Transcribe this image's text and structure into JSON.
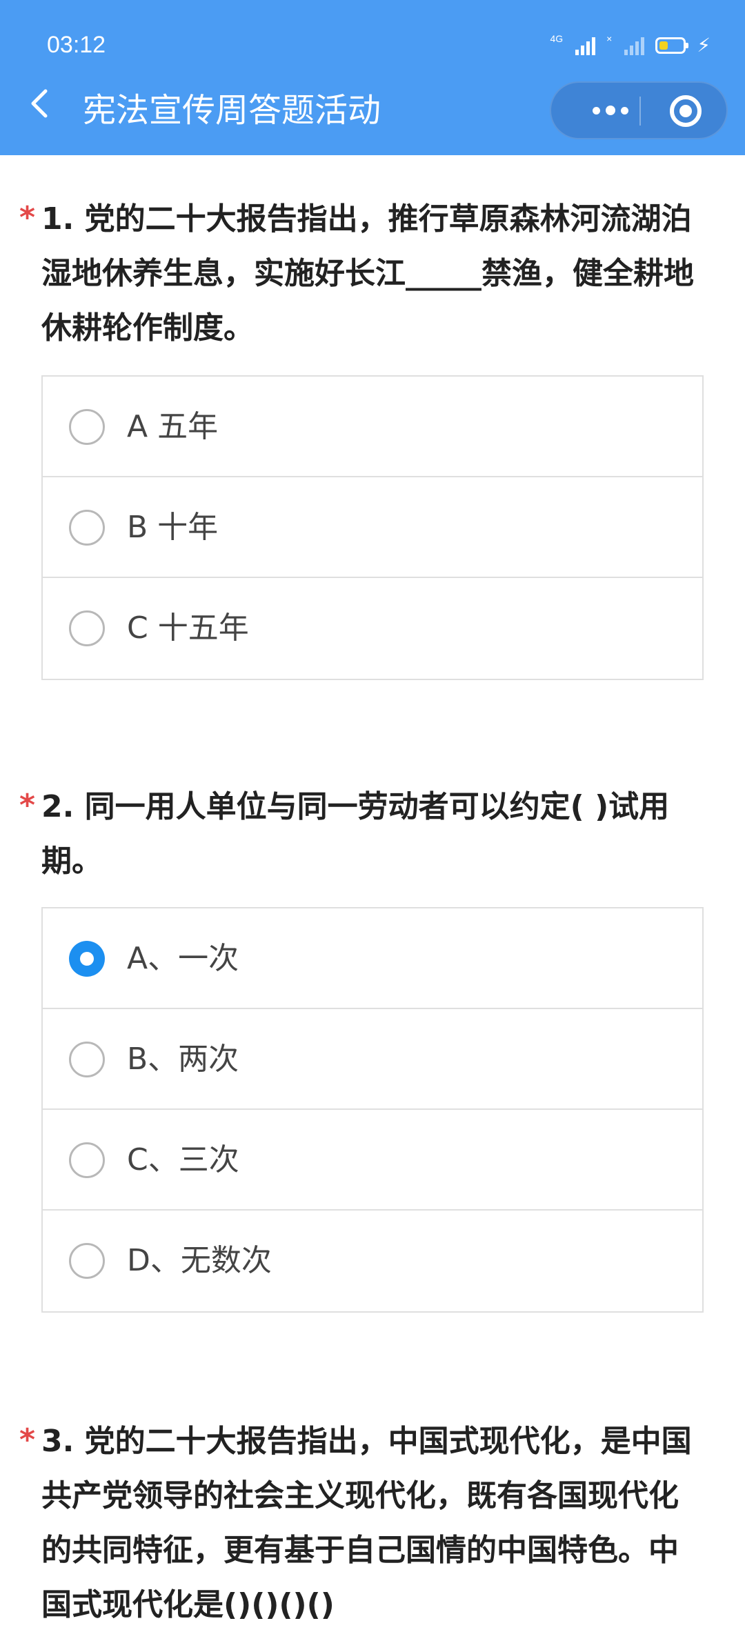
{
  "status": {
    "time": "03:12",
    "network": "4G",
    "sim2": "×"
  },
  "header": {
    "title": "宪法宣传周答题活动"
  },
  "questions": [
    {
      "star": "*",
      "text": "1. 党的二十大报告指出，推行草原森林河流湖泊湿地休养生息，实施好长江_____禁渔，健全耕地休耕轮作制度。",
      "options": [
        {
          "label": "A 五年",
          "checked": false
        },
        {
          "label": "B 十年",
          "checked": false
        },
        {
          "label": "C 十五年",
          "checked": false
        }
      ]
    },
    {
      "star": "*",
      "text": "2. 同一用人单位与同一劳动者可以约定( )试用期。",
      "options": [
        {
          "label": "A、一次",
          "checked": true
        },
        {
          "label": "B、两次",
          "checked": false
        },
        {
          "label": "C、三次",
          "checked": false
        },
        {
          "label": "D、无数次",
          "checked": false
        }
      ]
    },
    {
      "star": "*",
      "text": "3. 党的二十大报告指出，中国式现代化，是中国共产党领导的社会主义现代化，既有各国现代化的共同特征，更有基于自己国情的中国特色。中国式现代化是()()()()"
    }
  ],
  "colors": {
    "header": "#4b9cf3",
    "selected": "#1c8ff0",
    "required": "#e34848"
  }
}
